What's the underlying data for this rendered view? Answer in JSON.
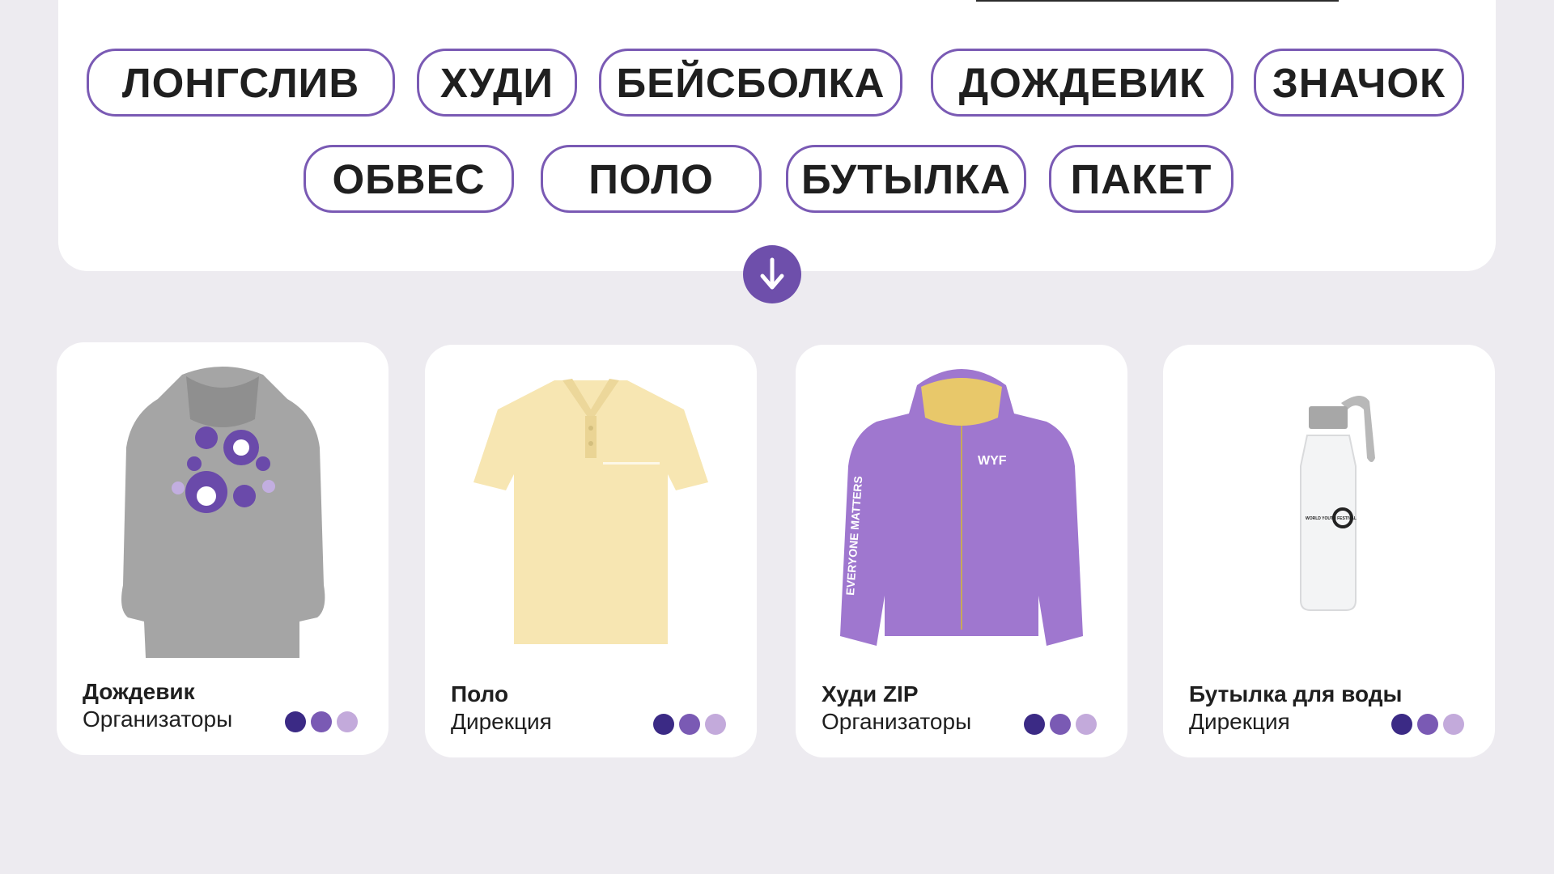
{
  "filters": {
    "row1": [
      "ЛОНГСЛИВ",
      "ХУДИ",
      "БЕЙСБОЛКА",
      "ДОЖДЕВИК",
      "ЗНАЧОК"
    ],
    "row2": [
      "ОБВЕС",
      "ПОЛО",
      "БУТЫЛКА",
      "ПАКЕТ"
    ]
  },
  "products": [
    {
      "title": "Дождевик",
      "subtitle": "Организаторы",
      "image_icon": "raincoat-icon"
    },
    {
      "title": "Поло",
      "subtitle": "Дирекция",
      "image_icon": "polo-shirt-icon"
    },
    {
      "title": "Худи ZIP",
      "subtitle": "Организаторы",
      "image_icon": "zip-hoodie-icon",
      "sleeve_text": "EVERYONE MATTERS",
      "logo_text": "WYF"
    },
    {
      "title": "Бутылка для воды",
      "subtitle": "Дирекция",
      "image_icon": "water-bottle-icon",
      "label_text": "WORLD YOUTH FESTIVAL"
    }
  ],
  "color_swatches": [
    "#3b2a85",
    "#7a5ab4",
    "#c3aadb"
  ],
  "colors": {
    "accent": "#6e4fab",
    "chip_border": "#7a5ab4",
    "background": "#edebf0"
  }
}
